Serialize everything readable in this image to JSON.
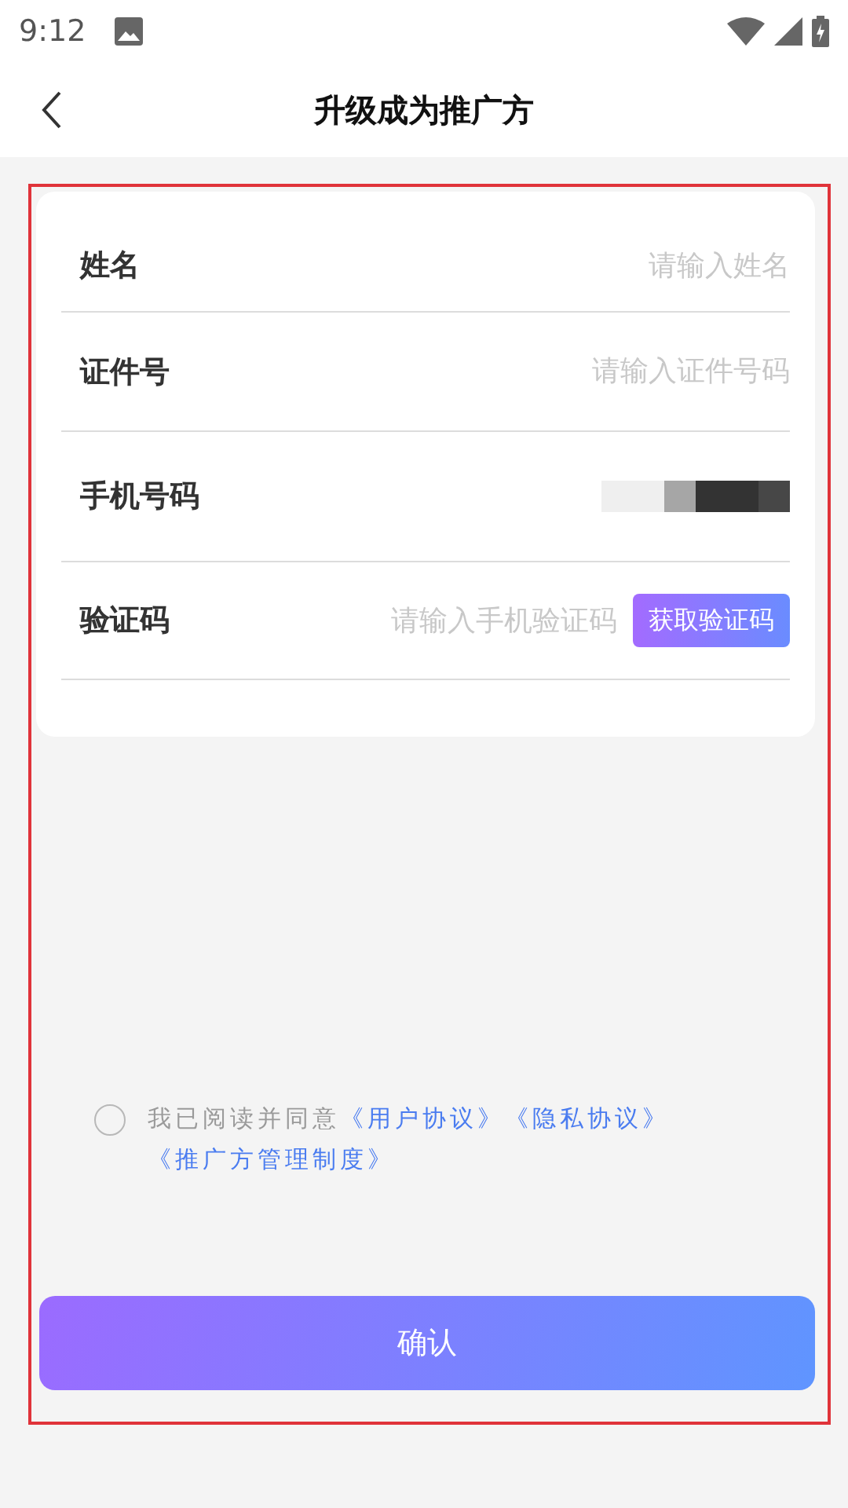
{
  "status_bar": {
    "time": "9:12"
  },
  "header": {
    "title": "升级成为推广方"
  },
  "form": {
    "fields": [
      {
        "kind": "text",
        "label": "姓名",
        "placeholder": "请输入姓名"
      },
      {
        "kind": "text",
        "label": "证件号",
        "placeholder": "请输入证件号码"
      },
      {
        "kind": "masked",
        "label": "手机号码"
      },
      {
        "kind": "code",
        "label": "验证码",
        "placeholder": "请输入手机验证码",
        "button": "获取验证码"
      }
    ]
  },
  "agreement": {
    "checked": false,
    "text": "我已阅读并同意",
    "links": [
      "《用户协议》",
      "《隐私协议》",
      "《推广方管理制度》"
    ]
  },
  "confirm_button": "确认"
}
